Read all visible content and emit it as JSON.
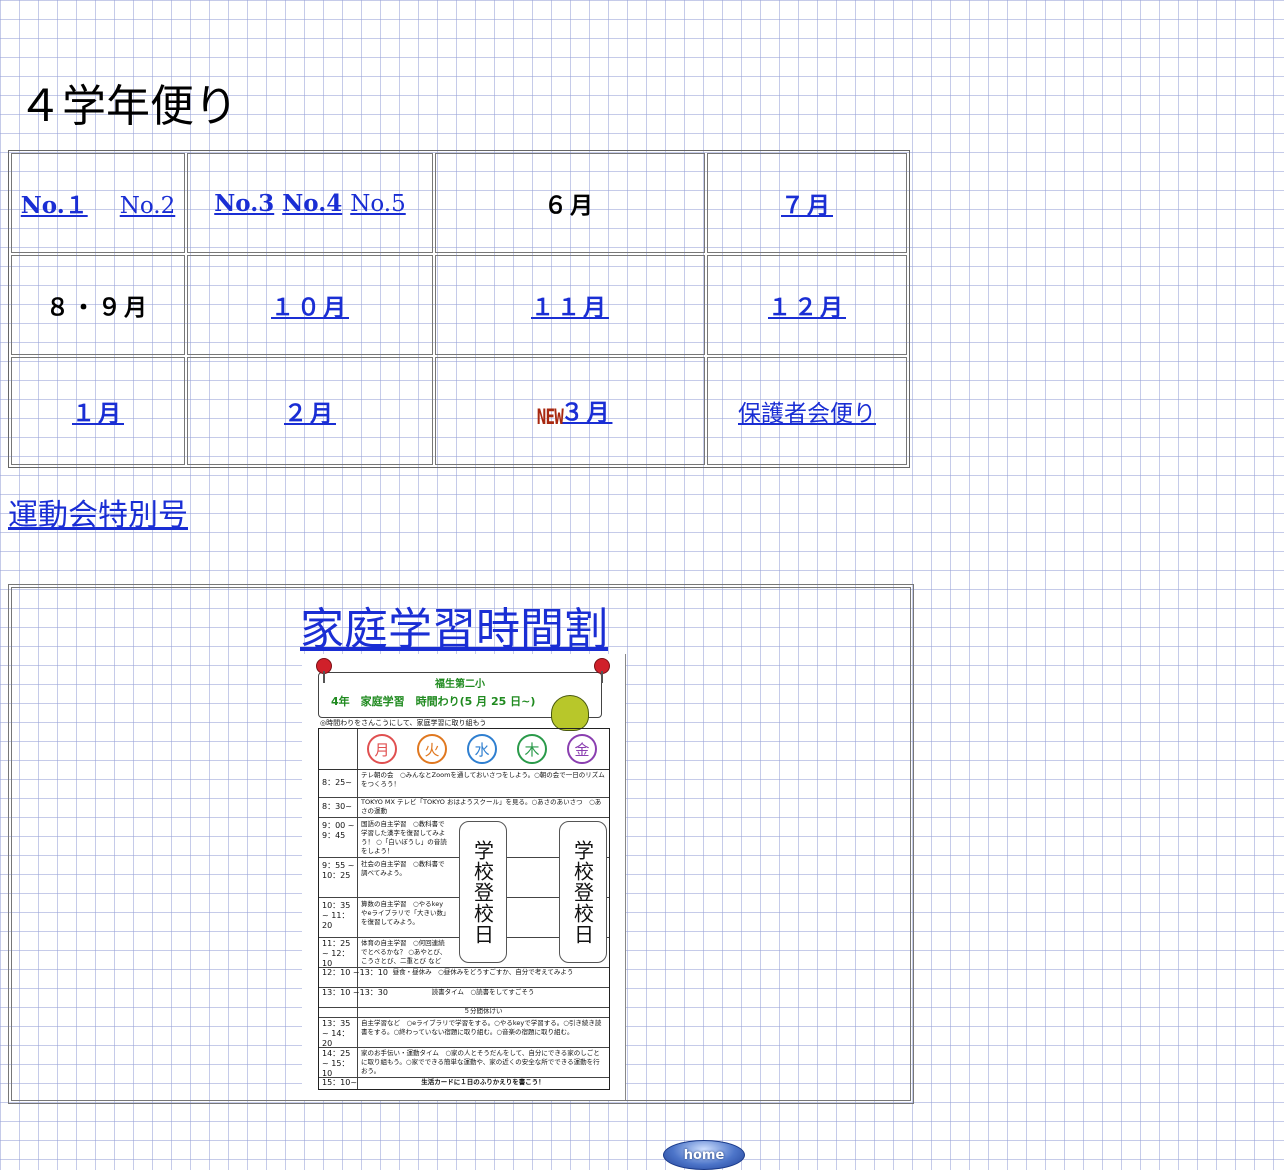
{
  "page_title": "４学年便り",
  "grid": {
    "row1": {
      "no1": "No.１",
      "no2": "No.2",
      "no3": "No.3",
      "no4": "No.4",
      "no5": "No.5",
      "june": "６月",
      "july": "７月"
    },
    "row2": {
      "aug_sep": "８・９月",
      "october": "１０月",
      "november": "１１月",
      "december": "１２月"
    },
    "row3": {
      "january": "１月",
      "february": "２月",
      "new_badge": "NEW",
      "march": "３月",
      "guardians_letter": "保護者会便り"
    }
  },
  "sports_day_link": "運動会特別号",
  "schedule": {
    "title": "家庭学習時間割",
    "image": {
      "school_name": "福生第二小",
      "heading": "4年　家庭学習　時間わり(5 月 25 日~)",
      "note": "◎時間わりをさんこうにして、家庭学習に取り組もう",
      "days": [
        {
          "name": "月",
          "color": "#e05050"
        },
        {
          "name": "火",
          "color": "#e07820"
        },
        {
          "name": "水",
          "color": "#2f7fd0"
        },
        {
          "name": "木",
          "color": "#2a9a4a"
        },
        {
          "name": "金",
          "color": "#8a3fb0"
        }
      ],
      "school_day_label": "学校登校日",
      "rows": [
        {
          "time": "8：25~",
          "text": "テレ朝の会　○みんなとZoomを通しておいさつをしよう。○朝の会で一日のリズムをつくろう！"
        },
        {
          "time": "8：30~",
          "text": "TOKYO MX テレビ「TOKYO おはようスクール」を見る。○あさのあいさつ　○あさの運動"
        },
        {
          "time": "9：00 ~ 9：45",
          "text": "国語の自主学習　○教科書で学習した漢字を復習してみよう！ ○「白いぼうし」の音読をしよう！"
        },
        {
          "time": "9：55 ~ 10：25",
          "text": "社会の自主学習　○教科書で調べてみよう。"
        },
        {
          "time": "10：35 ~ 11：20",
          "text": "算数の自主学習　○やるkeyやeライブラリで「大きい数」を復習してみよう。"
        },
        {
          "time": "11：25 ~ 12：10",
          "text": "体育の自主学習　○何回連続でとべるかな？ ○あやとび、こうさとび、二重とび など"
        },
        {
          "time": "12：10 ~13：10",
          "text": "昼食・昼休み　○昼休みをどうすごすか、自分で考えてみよう"
        },
        {
          "time": "13：10 ~13：30",
          "text": "読書タイム　○読書をしてすごそう"
        },
        {
          "time": "",
          "text": "５分間休けい"
        },
        {
          "time": "13：35 ~ 14：20",
          "text": "自主学習など　○eライブラリで学習をする。○やるkeyで学習する。○引き続き読書をする。○終わっていない宿題に取り組む。○音楽の宿題に取り組む。"
        },
        {
          "time": "14：25 ~ 15：10",
          "text": "家のお手伝い・運動タイム　○家の人とそうだんをして、自分にできる家のしごとに取り組もう。○家でできる簡単な運動や、家の近くの安全な所でできる運動を行おう。"
        },
        {
          "time": "15：10~",
          "text": "生活カードに１日のふりかえりを書こう！"
        }
      ]
    }
  },
  "home_button": "home"
}
